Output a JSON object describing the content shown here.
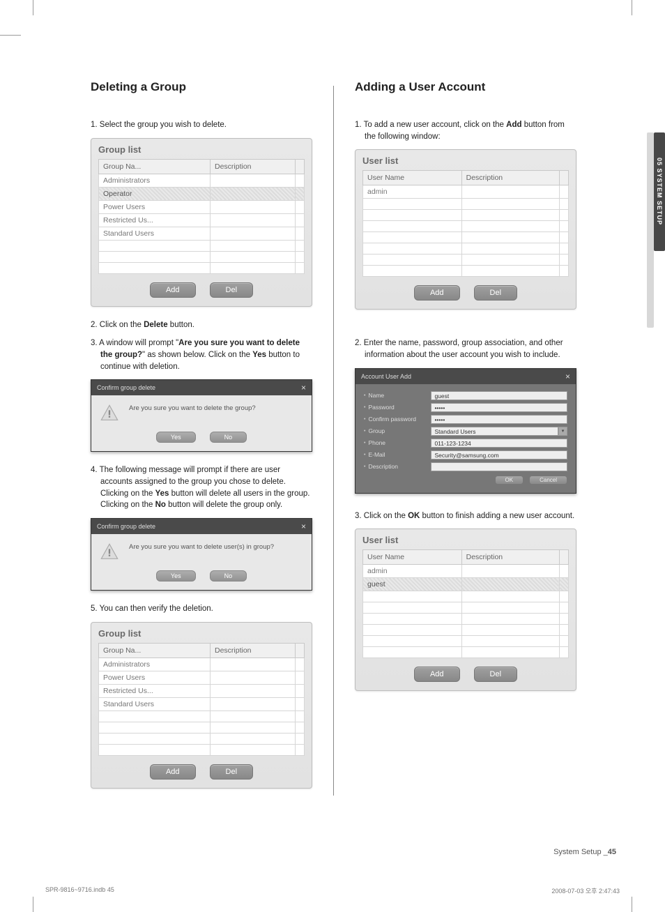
{
  "side_tab": "05 SYSTEM SETUP",
  "footer": {
    "label": "System Setup _",
    "page": "45"
  },
  "print": {
    "file": "SPR-9816~9716.indb   45",
    "ts": "2008-07-03   오후 2:47:43"
  },
  "left": {
    "heading": "Deleting a Group",
    "step1": {
      "num": "1.",
      "text": " Select the group you wish to delete."
    },
    "panel1": {
      "title": "Group list",
      "cols": [
        "Group Na...",
        "Description"
      ],
      "rows": [
        "Administrators",
        "Operator",
        "Power Users",
        "Restricted Us...",
        "Standard Users"
      ],
      "btns": [
        "Add",
        "Del"
      ]
    },
    "step2": {
      "num": "2.",
      "pre": " Click on the ",
      "b": "Delete",
      "post": " button."
    },
    "step3": {
      "num": "3.",
      "pre": " A window will prompt \"",
      "b1": "Are you sure you want to delete the group?",
      "mid": "\" as shown below. Click on the ",
      "b2": "Yes",
      "post": " button to continue with deletion."
    },
    "dialog1": {
      "title": "Confirm group delete",
      "text": "Are you sure you want to delete the group?",
      "yes": "Yes",
      "no": "No"
    },
    "step4": {
      "num": "4.",
      "pre": " The following message will prompt if there are user accounts assigned to the group you chose to delete. Clicking on the ",
      "b1": "Yes",
      "mid": " button will delete all users in the group. Clicking on the ",
      "b2": "No",
      "post": " button will delete the group only."
    },
    "dialog2": {
      "title": "Confirm group delete",
      "text": "Are you sure you want to delete user(s) in group?",
      "yes": "Yes",
      "no": "No"
    },
    "step5": {
      "num": "5.",
      "text": " You can then verify the deletion."
    },
    "panel2": {
      "title": "Group list",
      "cols": [
        "Group Na...",
        "Description"
      ],
      "rows": [
        "Administrators",
        "Power Users",
        "Restricted Us...",
        "Standard Users"
      ],
      "btns": [
        "Add",
        "Del"
      ]
    }
  },
  "right": {
    "heading": "Adding a User Account",
    "step1": {
      "num": "1.",
      "pre": " To add a new user account, click on the ",
      "b": "Add",
      "post": " button from the following window:"
    },
    "panel1": {
      "title": "User list",
      "cols": [
        "User Name",
        "Description"
      ],
      "rows": [
        "admin"
      ],
      "btns": [
        "Add",
        "Del"
      ]
    },
    "step2": {
      "num": "2.",
      "text": " Enter the name, password, group association, and other information about the user account you wish to  include."
    },
    "form": {
      "title": "Account User Add",
      "fields": [
        {
          "label": "Name",
          "value": "guest"
        },
        {
          "label": "Password",
          "value": "•••••"
        },
        {
          "label": "Confirm password",
          "value": "•••••"
        },
        {
          "label": "Group",
          "value": "Standard Users",
          "select": true
        },
        {
          "label": "Phone",
          "value": "011-123-1234"
        },
        {
          "label": "E-Mail",
          "value": "Security@samsung.com"
        },
        {
          "label": "Description",
          "value": ""
        }
      ],
      "ok": "OK",
      "cancel": "Cancel"
    },
    "step3": {
      "num": "3.",
      "pre": " Click on the ",
      "b": "OK",
      "post": " button to finish adding a new user account."
    },
    "panel2": {
      "title": "User list",
      "cols": [
        "User Name",
        "Description"
      ],
      "rows": [
        "admin",
        "guest"
      ],
      "btns": [
        "Add",
        "Del"
      ]
    }
  }
}
